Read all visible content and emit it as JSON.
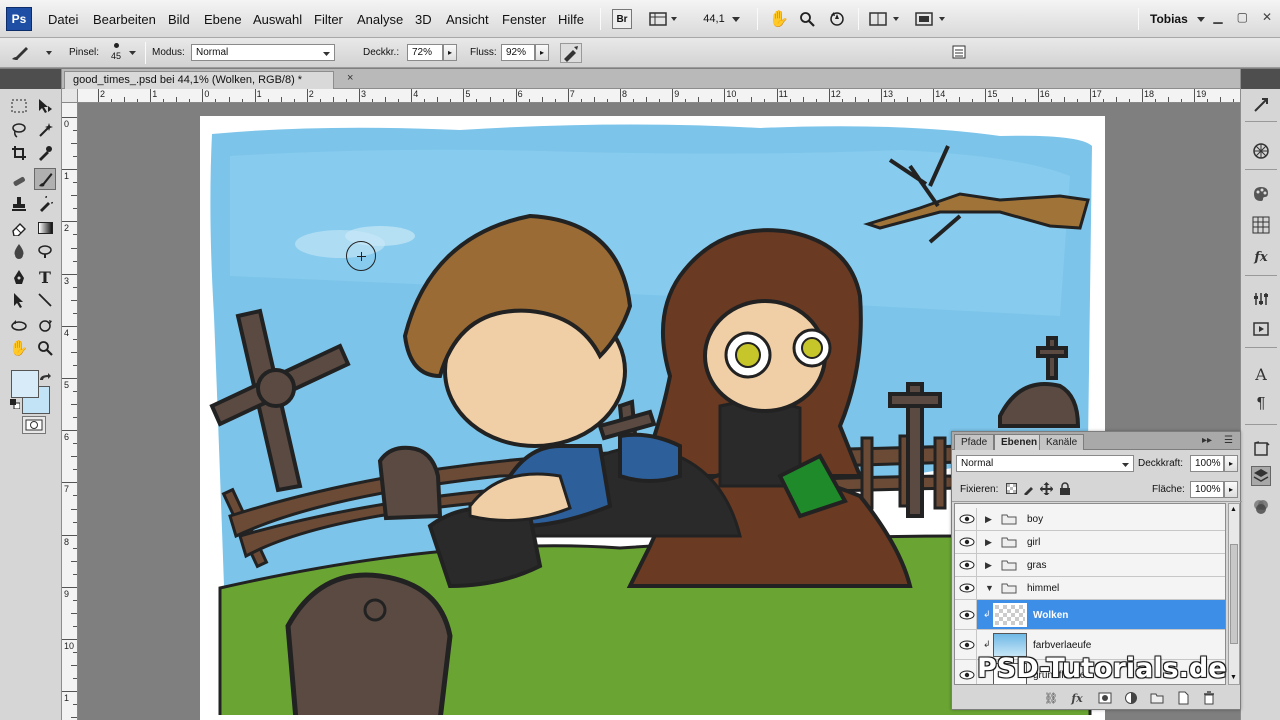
{
  "menubar": {
    "logo": "Ps",
    "items": [
      "Datei",
      "Bearbeiten",
      "Bild",
      "Ebene",
      "Auswahl",
      "Filter",
      "Analyse",
      "3D",
      "Ansicht",
      "Fenster",
      "Hilfe"
    ],
    "bridge_label": "Br",
    "zoom_value": "44,1",
    "user": "Tobias"
  },
  "options": {
    "brush_label": "Pinsel:",
    "brush_size": "45",
    "mode_label": "Modus:",
    "mode_value": "Normal",
    "opacity_label": "Deckkr.:",
    "opacity_value": "72%",
    "flow_label": "Fluss:",
    "flow_value": "92%"
  },
  "document": {
    "tab_title": "good_times_.psd bei 44,1% (Wolken, RGB/8) *",
    "close_glyph": "×"
  },
  "rulers": {
    "h_labels": [
      "2",
      "1",
      "0",
      "1",
      "2",
      "3",
      "4",
      "5",
      "6",
      "7",
      "8",
      "9",
      "10",
      "11",
      "12",
      "13",
      "14",
      "15",
      "16",
      "17",
      "18",
      "19"
    ],
    "v_labels": [
      "0",
      "1",
      "2",
      "3",
      "4",
      "5",
      "6",
      "7",
      "8",
      "9",
      "10",
      "1"
    ]
  },
  "layers_panel": {
    "tabs": [
      "Pfade",
      "Ebenen",
      "Kanäle"
    ],
    "active_tab": "Ebenen",
    "blend_mode": "Normal",
    "opacity_label": "Deckkraft:",
    "opacity_value": "100%",
    "lock_label": "Fixieren:",
    "fill_label": "Fläche:",
    "fill_value": "100%",
    "layers": [
      {
        "name": "boy",
        "type": "group",
        "expanded": false
      },
      {
        "name": "girl",
        "type": "group",
        "expanded": false
      },
      {
        "name": "gras",
        "type": "group",
        "expanded": false
      },
      {
        "name": "himmel",
        "type": "group",
        "expanded": true
      },
      {
        "name": "Wolken",
        "type": "layer",
        "selected": true
      },
      {
        "name": "farbverlaeufe",
        "type": "layer",
        "selected": false
      },
      {
        "name": "grundfläche",
        "type": "layer",
        "selected": false
      }
    ]
  },
  "watermark": "PSD-Tutorials.de",
  "colors": {
    "selection_blue": "#3d8ee7",
    "sky": "#7cc4ea",
    "grass": "#6aa534",
    "foreground_swatch": "#d7ecf8",
    "background_swatch": "#c2e3f5"
  }
}
